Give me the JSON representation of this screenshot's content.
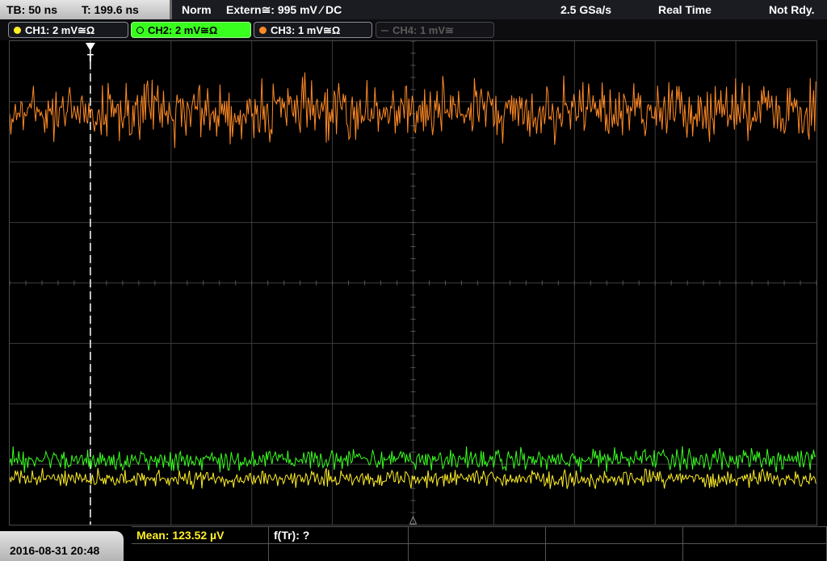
{
  "topbar": {
    "timebase": "TB: 50 ns",
    "trigger_time": "T: 199.6 ns",
    "mode": "Norm",
    "trigger_source": "Extern≅: 995 mV ⁄ DC",
    "sample_rate": "2.5 GSa/s",
    "acquisition": "Real Time",
    "status": "Not Rdy."
  },
  "channels": [
    {
      "label": "CH1: 2 mV≅Ω",
      "color": "#ffef26",
      "state": "on"
    },
    {
      "label": "CH2: 2 mV≅Ω",
      "color": "#39ff1f",
      "state": "active"
    },
    {
      "label": "CH3: 1 mV≅Ω",
      "color": "#ff8a25",
      "state": "on"
    },
    {
      "label": "CH4: 1 mV≅",
      "color": "#5b5b5b",
      "state": "off"
    }
  ],
  "trigger_marker": "T",
  "traces": [
    {
      "name": "CH3",
      "color": "#ff8a25",
      "level_fraction": 0.145,
      "amplitude_fraction": 0.085
    },
    {
      "name": "CH2",
      "color": "#39ff1f",
      "level_fraction": 0.865,
      "amplitude_fraction": 0.032
    },
    {
      "name": "CH1",
      "color": "#ffef26",
      "level_fraction": 0.905,
      "amplitude_fraction": 0.026
    }
  ],
  "trigger_position_fraction": 0.1,
  "bottombar": {
    "datetime": "2016-08-31 20:48",
    "measurements": {
      "mean": "Mean: 123.52 µV",
      "freq": "f(Tr): ?"
    }
  }
}
